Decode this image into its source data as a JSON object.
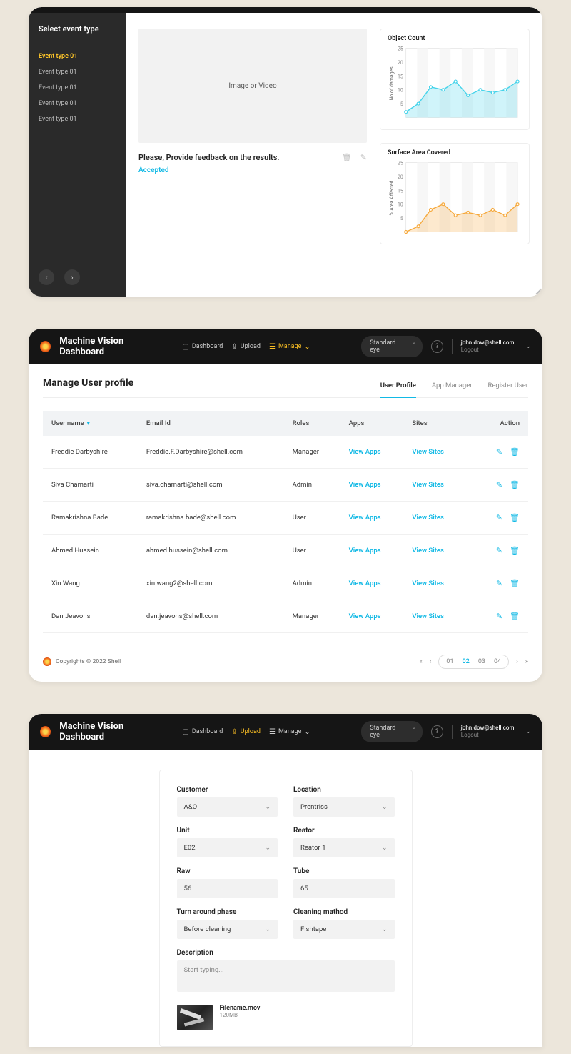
{
  "global": {
    "app_title": "Machine Vision Dashboard",
    "user_email": "john.dow@shell.com",
    "logout": "Logout",
    "copyright": "Copyrights © 2022 Shell"
  },
  "nav": {
    "dashboard": "Dashboard",
    "upload": "Upload",
    "manage": "Manage",
    "camera_select": "Standard eye"
  },
  "card1": {
    "sidebar_title": "Select event type",
    "events": [
      "Event type 01",
      "Event type 01",
      "Event type 01",
      "Event type 01",
      "Event type 01"
    ],
    "preview_placeholder": "Image or Video",
    "feedback_prompt": "Please, Provide feedback on the results.",
    "status": "Accepted",
    "chart1_title": "Object Count",
    "chart2_title": "Surface Area Covered",
    "chart1_yaxis": "No.of damages",
    "chart2_yaxis": "% Area Affected",
    "y_ticks": [
      "25",
      "20",
      "15",
      "10",
      "5"
    ]
  },
  "chart_data": [
    {
      "type": "area",
      "title": "Object Count",
      "ylabel": "No.of damages",
      "ylim": [
        0,
        25
      ],
      "x": [
        0,
        1,
        2,
        3,
        4,
        5,
        6,
        7,
        8,
        9
      ],
      "values": [
        2,
        5,
        11,
        10,
        13,
        8,
        10,
        9,
        10,
        13
      ],
      "color": "#45d3ea"
    },
    {
      "type": "area",
      "title": "Surface Area Covered",
      "ylabel": "% Area Affected",
      "ylim": [
        0,
        25
      ],
      "x": [
        0,
        1,
        2,
        3,
        4,
        5,
        6,
        7,
        8,
        9
      ],
      "values": [
        0,
        2,
        8,
        10,
        6,
        7,
        6,
        8,
        6,
        10
      ],
      "color": "#f6a93c"
    }
  ],
  "card2": {
    "page_title": "Manage User profile",
    "tabs": [
      "User Profile",
      "App Manager",
      "Register User"
    ],
    "columns": [
      "User name",
      "Email Id",
      "Roles",
      "Apps",
      "Sites",
      "Action"
    ],
    "view_apps": "View Apps",
    "view_sites": "View Sites",
    "rows": [
      {
        "name": "Freddie Darbyshire",
        "email": "Freddie.F.Darbyshire@shell.com",
        "role": "Manager"
      },
      {
        "name": "Siva Chamarti",
        "email": "siva.chamarti@shell.com",
        "role": "Admin"
      },
      {
        "name": "Ramakrishna Bade",
        "email": "ramakrishna.bade@shell.com",
        "role": "User"
      },
      {
        "name": "Ahmed Hussein",
        "email": "ahmed.hussein@shell.com",
        "role": "User"
      },
      {
        "name": "Xin Wang",
        "email": "xin.wang2@shell.com",
        "role": "Admin"
      },
      {
        "name": "Dan Jeavons",
        "email": "dan.jeavons@shell.com",
        "role": "Manager"
      }
    ],
    "pages": [
      "01",
      "02",
      "03",
      "04"
    ]
  },
  "card3": {
    "labels": {
      "customer": "Customer",
      "location": "Location",
      "unit": "Unit",
      "reator": "Reator",
      "raw": "Raw",
      "tube": "Tube",
      "phase": "Turn around phase",
      "method": "Cleaning mathod",
      "description": "Description"
    },
    "values": {
      "customer": "A&O",
      "location": "Prentriss",
      "unit": "E02",
      "reator": "Reator 1",
      "raw": "56",
      "tube": "65",
      "phase": "Before cleaning",
      "method": "Fishtape"
    },
    "desc_placeholder": "Start typing...",
    "file_name": "Filename.mov",
    "file_size": "120MB"
  }
}
